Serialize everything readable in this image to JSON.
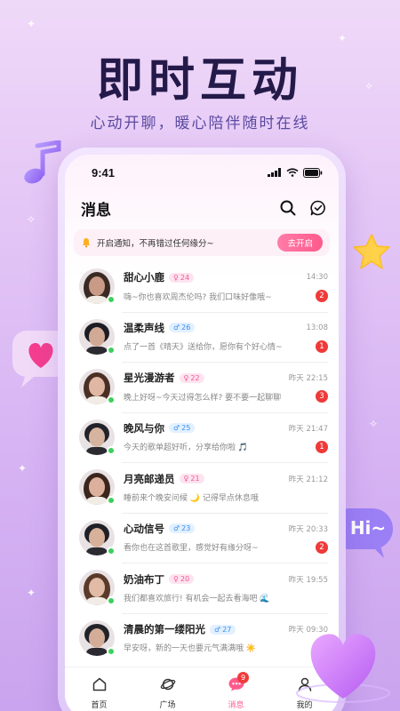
{
  "hero": {
    "title": "即时互动",
    "subtitle": "心动开聊，暖心陪伴随时在线"
  },
  "decorations": {
    "hi_bubble": "Hi~"
  },
  "status_bar": {
    "time": "9:41"
  },
  "header": {
    "title": "消息"
  },
  "notice": {
    "text": "开启通知，不再错过任何缘分~",
    "button": "去开启"
  },
  "conversations": [
    {
      "name": "甜心小鹿",
      "gender": "female",
      "age": "24",
      "time": "14:30",
      "preview": "嗨~你也喜欢周杰伦吗? 我们口味好像哦~",
      "unread": "2",
      "avatar_color": "#c99a86",
      "hair": "#3a2a24"
    },
    {
      "name": "温柔声线",
      "gender": "male",
      "age": "26",
      "time": "13:08",
      "preview": "点了一首《晴天》送给你，愿你有个好心情~",
      "unread": "1",
      "avatar_color": "#d2a994",
      "hair": "#1c1c24"
    },
    {
      "name": "星光漫游者",
      "gender": "female",
      "age": "22",
      "time": "昨天 22:15",
      "preview": "晚上好呀~今天过得怎么样? 要不要一起聊聊",
      "unread": "3",
      "avatar_color": "#e0b7a2",
      "hair": "#4a2f25"
    },
    {
      "name": "晚风与你",
      "gender": "male",
      "age": "25",
      "time": "昨天 21:47",
      "preview": "今天的歌单超好听，分享给你啦 🎵",
      "unread": "1",
      "avatar_color": "#d6b4a0",
      "hair": "#22222a"
    },
    {
      "name": "月亮邮递员",
      "gender": "female",
      "age": "21",
      "time": "昨天 21:12",
      "preview": "睡前来个晚安问候 🌙 记得早点休息哦",
      "unread": "",
      "avatar_color": "#dcb09c",
      "hair": "#3b261d"
    },
    {
      "name": "心动信号",
      "gender": "male",
      "age": "23",
      "time": "昨天 20:33",
      "preview": "看你也在这首歌里，感觉好有缘分呀~",
      "unread": "2",
      "avatar_color": "#d8b19b",
      "hair": "#1f1f26"
    },
    {
      "name": "奶油布丁",
      "gender": "female",
      "age": "20",
      "time": "昨天 19:55",
      "preview": "我们都喜欢旅行! 有机会一起去看海吧 🌊",
      "unread": "",
      "avatar_color": "#e2bba6",
      "hair": "#5a3a2a"
    },
    {
      "name": "清晨的第一缕阳光",
      "gender": "male",
      "age": "27",
      "time": "昨天 09:30",
      "preview": "早安呀，新的一天也要元气满满哦 ☀️",
      "unread": "",
      "avatar_color": "#d4ad98",
      "hair": "#222229"
    }
  ],
  "tabbar": [
    {
      "label": "首页",
      "icon": "home-icon",
      "badge": ""
    },
    {
      "label": "广场",
      "icon": "planet-icon",
      "badge": ""
    },
    {
      "label": "消息",
      "icon": "message-icon",
      "badge": "9",
      "active": true
    },
    {
      "label": "我的",
      "icon": "profile-icon",
      "badge": ""
    }
  ],
  "colors": {
    "accent": "#ff5a8c",
    "female_tag": "#f2579a",
    "male_tag": "#3a8ef3",
    "unread_badge": "#ef3a3a",
    "online_dot": "#3ccf5c",
    "hero_title": "#241a4a"
  }
}
